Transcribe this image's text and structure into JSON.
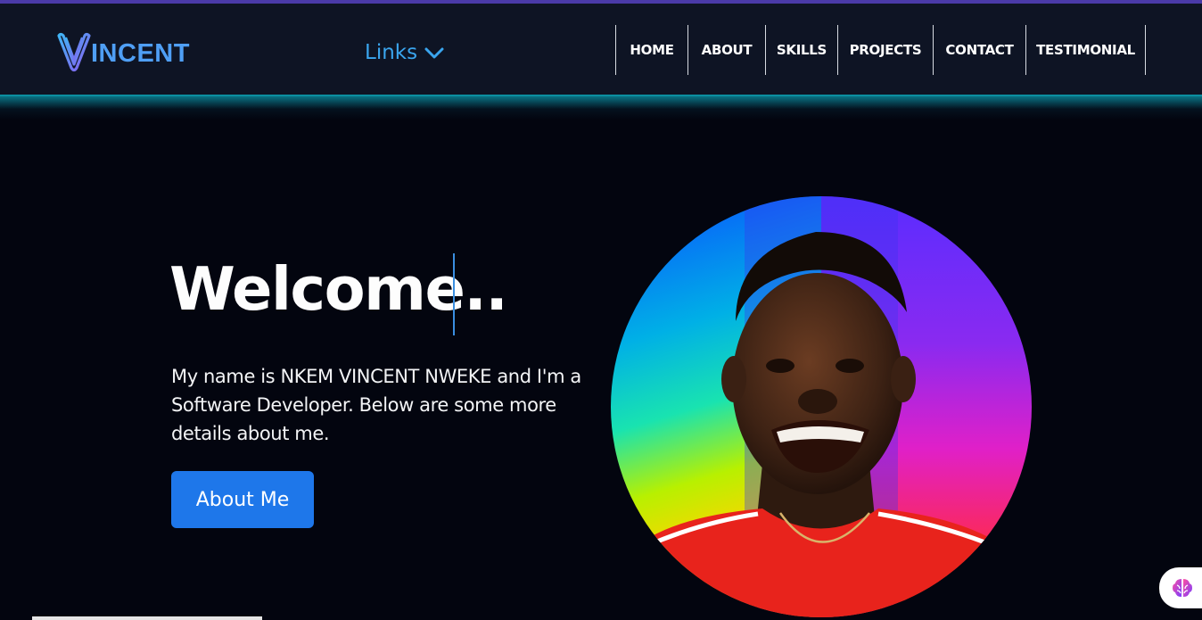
{
  "logo": {
    "text": "INCENT",
    "icon": "v-logo-icon"
  },
  "links_menu": {
    "label": "Links",
    "icon": "chevron-down-icon"
  },
  "nav": {
    "items": [
      {
        "label": "HOME"
      },
      {
        "label": "ABOUT"
      },
      {
        "label": "SKILLS"
      },
      {
        "label": "PROJECTS"
      },
      {
        "label": "CONTACT"
      },
      {
        "label": "TESTIMONIAL"
      }
    ]
  },
  "hero": {
    "title": "Welcome..",
    "intro": "My name is NKEM VINCENT NWEKE and I'm a Software Developer. Below are some more details about me.",
    "button_label": "About Me"
  },
  "profile_photo": {
    "icon": "profile-photo"
  },
  "assistant": {
    "icon": "brain-icon"
  },
  "colors": {
    "accent": "#4f9ff5",
    "button": "#1e77ea",
    "navbar": "#0e1424",
    "background": "#03050f",
    "nav_glow": "#0b8ea0"
  }
}
